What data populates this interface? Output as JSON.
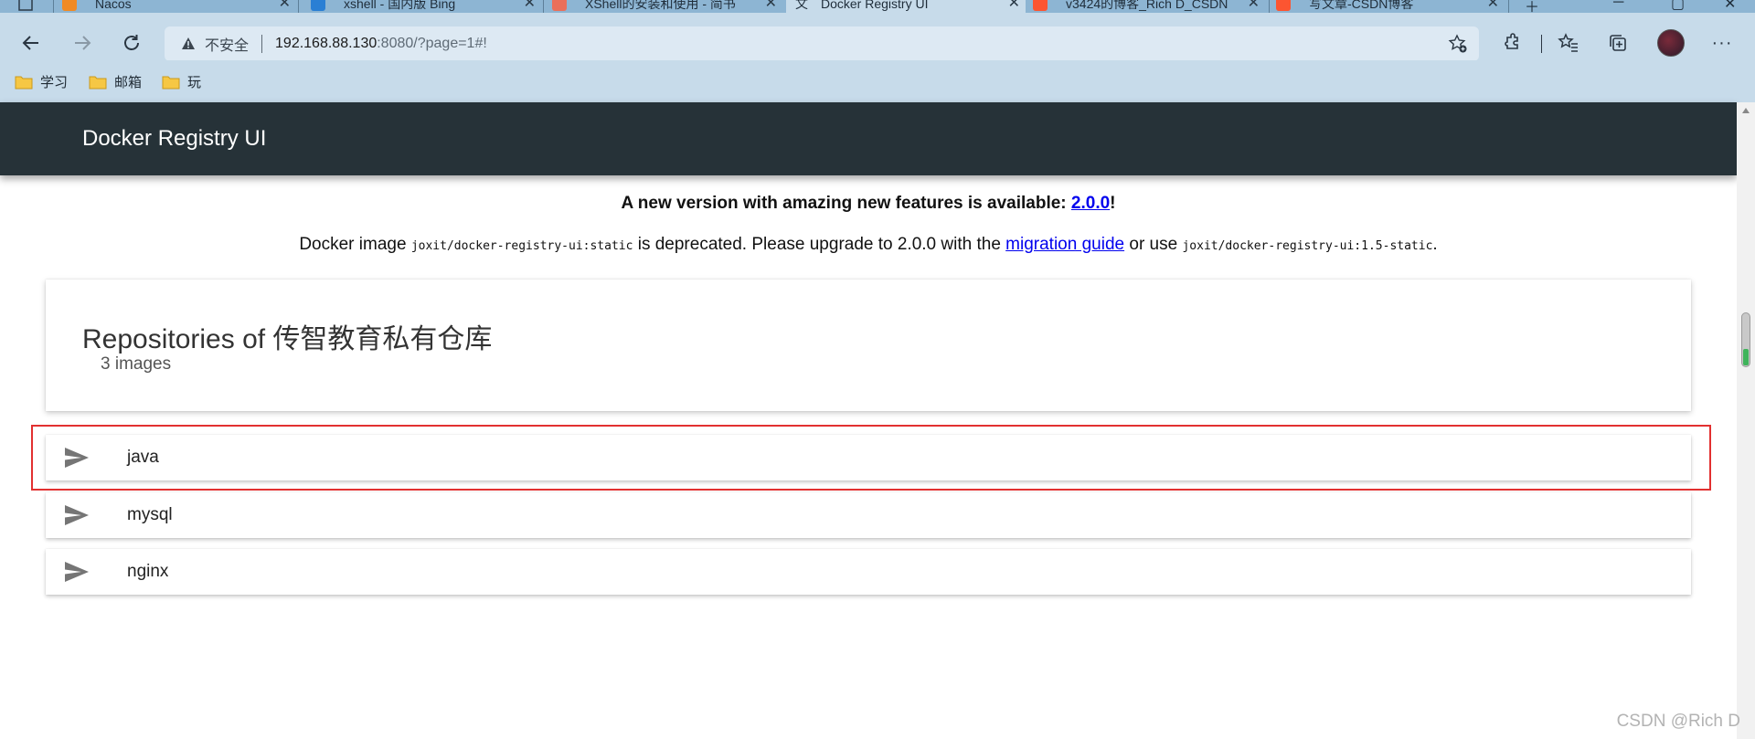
{
  "browser": {
    "tabs": [
      {
        "title": "Nacos",
        "favicon_color": "#f08a24"
      },
      {
        "title": "xshell - 国内版 Bing",
        "favicon_color": "#2a7fd4"
      },
      {
        "title": "XShell的安装和使用 - 简书",
        "favicon_color": "#ea6f5a"
      },
      {
        "title": "Docker Registry UI",
        "favicon_color": "#c7dbea",
        "active": true
      },
      {
        "title": "v3424的博客_Rich D_CSDN",
        "favicon_color": "#fc5531"
      },
      {
        "title": "写文章-CSDN博客",
        "favicon_color": "#fc5531"
      }
    ],
    "address": {
      "insecure_label": "不安全",
      "host": "192.168.88.130",
      "path": ":8080/?page=1#!"
    },
    "bookmarks": [
      {
        "label": "学习",
        "icon": "folder-icon"
      },
      {
        "label": "邮箱",
        "icon": "folder-icon"
      },
      {
        "label": "玩",
        "icon": "folder-icon"
      }
    ]
  },
  "app": {
    "title": "Docker Registry UI"
  },
  "notice": {
    "main_text": "A new version with amazing new features is available: ",
    "version_link": "2.0.0",
    "main_suffix": "!",
    "sub_prefix": "Docker image ",
    "deprecated_image": "joxit/docker-registry-ui:static",
    "sub_middle": " is deprecated. Please upgrade to 2.0.0 with the ",
    "migration_link": "migration guide",
    "sub_or": " or use ",
    "alt_image": "joxit/docker-registry-ui:1.5-static",
    "sub_end": "."
  },
  "repositories": {
    "title": "Repositories of 传智教育私有仓库",
    "count": "3 images",
    "items": [
      "java",
      "mysql",
      "nginx"
    ]
  },
  "watermark": "CSDN @Rich D",
  "colors": {
    "header_bg": "#263238",
    "highlight": "#e23030",
    "link": "#0000ee"
  }
}
